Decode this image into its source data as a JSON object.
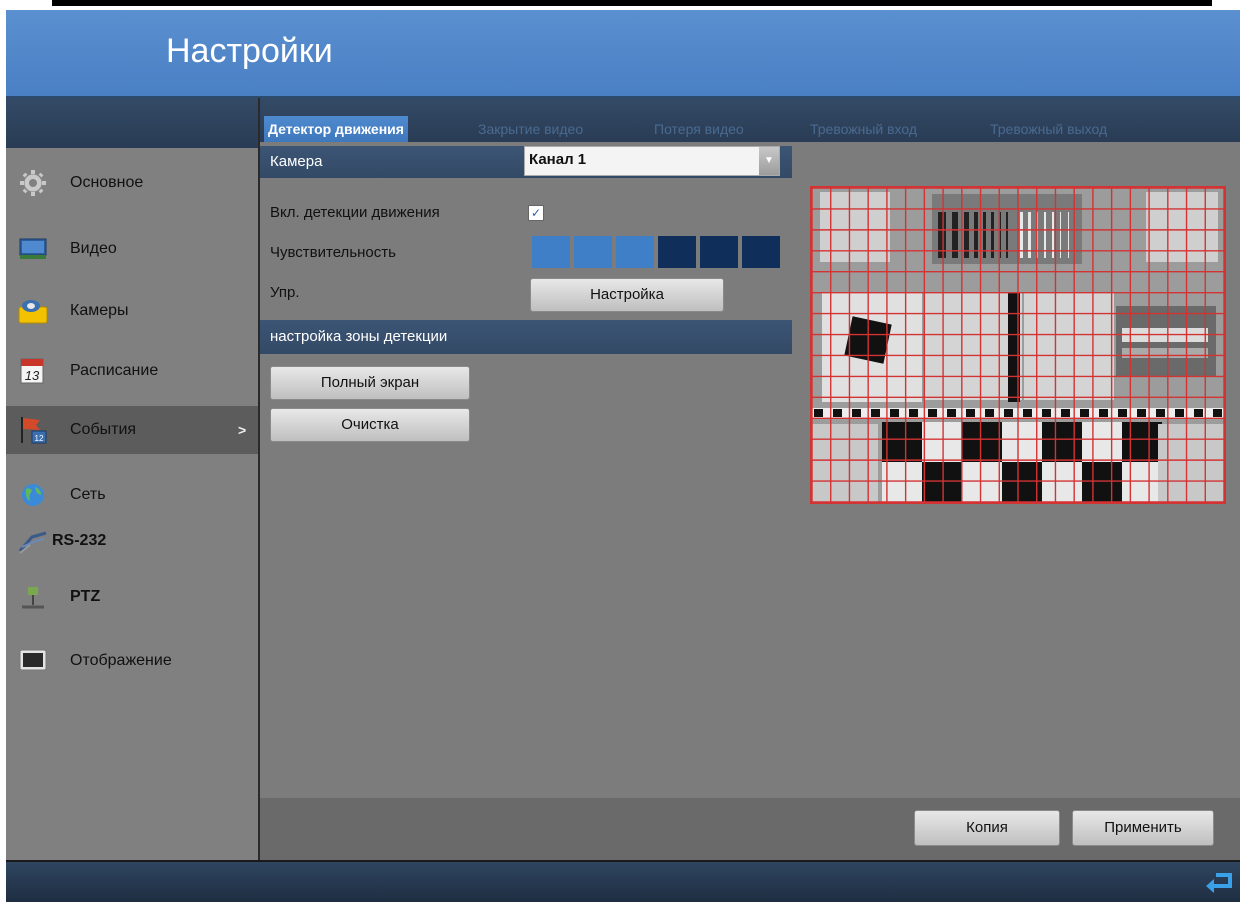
{
  "header": {
    "title": "Настройки"
  },
  "sidebar": {
    "items": [
      {
        "label": "Основное",
        "icon": "gear-icon"
      },
      {
        "label": "Видео",
        "icon": "monitor-icon"
      },
      {
        "label": "Камеры",
        "icon": "folder-camera-icon"
      },
      {
        "label": "Расписание",
        "icon": "calendar-icon"
      },
      {
        "label": "События",
        "icon": "flag-calendar-icon",
        "active": true,
        "arrow": ">"
      },
      {
        "label": "Сеть",
        "icon": "globe-icon"
      },
      {
        "label": "RS-232",
        "icon": "serial-cable-icon"
      },
      {
        "label": "PTZ",
        "icon": "ptz-icon"
      },
      {
        "label": "Отображение",
        "icon": "display-icon"
      }
    ]
  },
  "tabs": [
    {
      "label": "Детектор движения",
      "active": true
    },
    {
      "label": "Закрытие видео"
    },
    {
      "label": "Потеря видео"
    },
    {
      "label": "Тревожный вход"
    },
    {
      "label": "Тревожный выход"
    }
  ],
  "form": {
    "camera_label": "Камера",
    "camera_value": "Канал 1",
    "enable_label": "Вкл. детекции движения",
    "enable_checked": true,
    "sensitivity_label": "Чувствительность",
    "sensitivity_level": 3,
    "sensitivity_max": 6,
    "control_label": "Упр.",
    "control_button": "Настройка",
    "zone_section": "настройка зоны детекции",
    "fullscreen_button": "Полный экран",
    "clear_button": "Очистка"
  },
  "footer": {
    "copy_button": "Копия",
    "apply_button": "Применить"
  },
  "colors": {
    "accent": "#4a80c4",
    "dark_bar": "#2a3c55",
    "grid_line": "#d43333",
    "sensitivity_on": "#3f7fc8",
    "sensitivity_off": "#0f2f5a"
  }
}
